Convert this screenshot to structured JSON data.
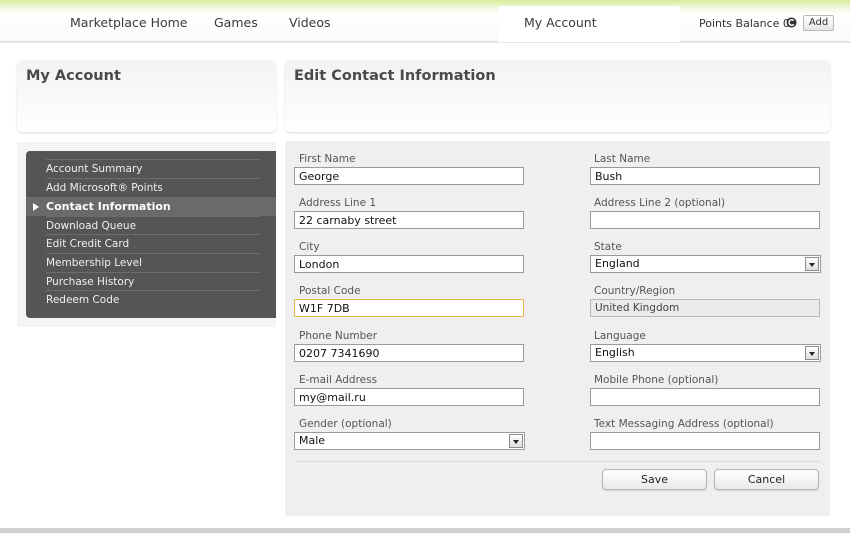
{
  "nav": {
    "items": [
      "Marketplace Home",
      "Games",
      "Videos"
    ],
    "active": "My Account",
    "points_label": "Points Balance 0",
    "add_label": "Add",
    "coin_icon": "points-coin-icon"
  },
  "sidebar": {
    "title": "My Account",
    "items": [
      {
        "label": "Account Summary",
        "active": false
      },
      {
        "label": "Add Microsoft® Points",
        "active": false
      },
      {
        "label": "Contact Information",
        "active": true
      },
      {
        "label": "Download Queue",
        "active": false
      },
      {
        "label": "Edit Credit Card",
        "active": false
      },
      {
        "label": "Membership Level",
        "active": false
      },
      {
        "label": "Purchase History",
        "active": false
      },
      {
        "label": "Redeem Code",
        "active": false
      }
    ]
  },
  "form": {
    "title": "Edit Contact Information",
    "first_name": {
      "label": "First Name",
      "value": "George"
    },
    "last_name": {
      "label": "Last Name",
      "value": "Bush"
    },
    "address1": {
      "label": "Address Line 1",
      "value": "22 carnaby street"
    },
    "address2": {
      "label": "Address Line 2 (optional)",
      "value": ""
    },
    "city": {
      "label": "City",
      "value": "London"
    },
    "state": {
      "label": "State",
      "value": "England"
    },
    "postal": {
      "label": "Postal Code",
      "value": "W1F 7DB"
    },
    "country": {
      "label": "Country/Region",
      "value": "United Kingdom"
    },
    "phone": {
      "label": "Phone Number",
      "value": "0207 7341690"
    },
    "language": {
      "label": "Language",
      "value": "English"
    },
    "email": {
      "label": "E-mail Address",
      "value": "my@mail.ru"
    },
    "mobile": {
      "label": "Mobile Phone (optional)",
      "value": ""
    },
    "gender": {
      "label": "Gender (optional)",
      "value": "Male"
    },
    "sms": {
      "label": "Text Messaging Address (optional)",
      "value": ""
    },
    "save_label": "Save",
    "cancel_label": "Cancel"
  },
  "colors": {
    "accent_green": "#d8ec9a",
    "menu_bg": "#555555",
    "focus_border": "#e6b64a"
  }
}
